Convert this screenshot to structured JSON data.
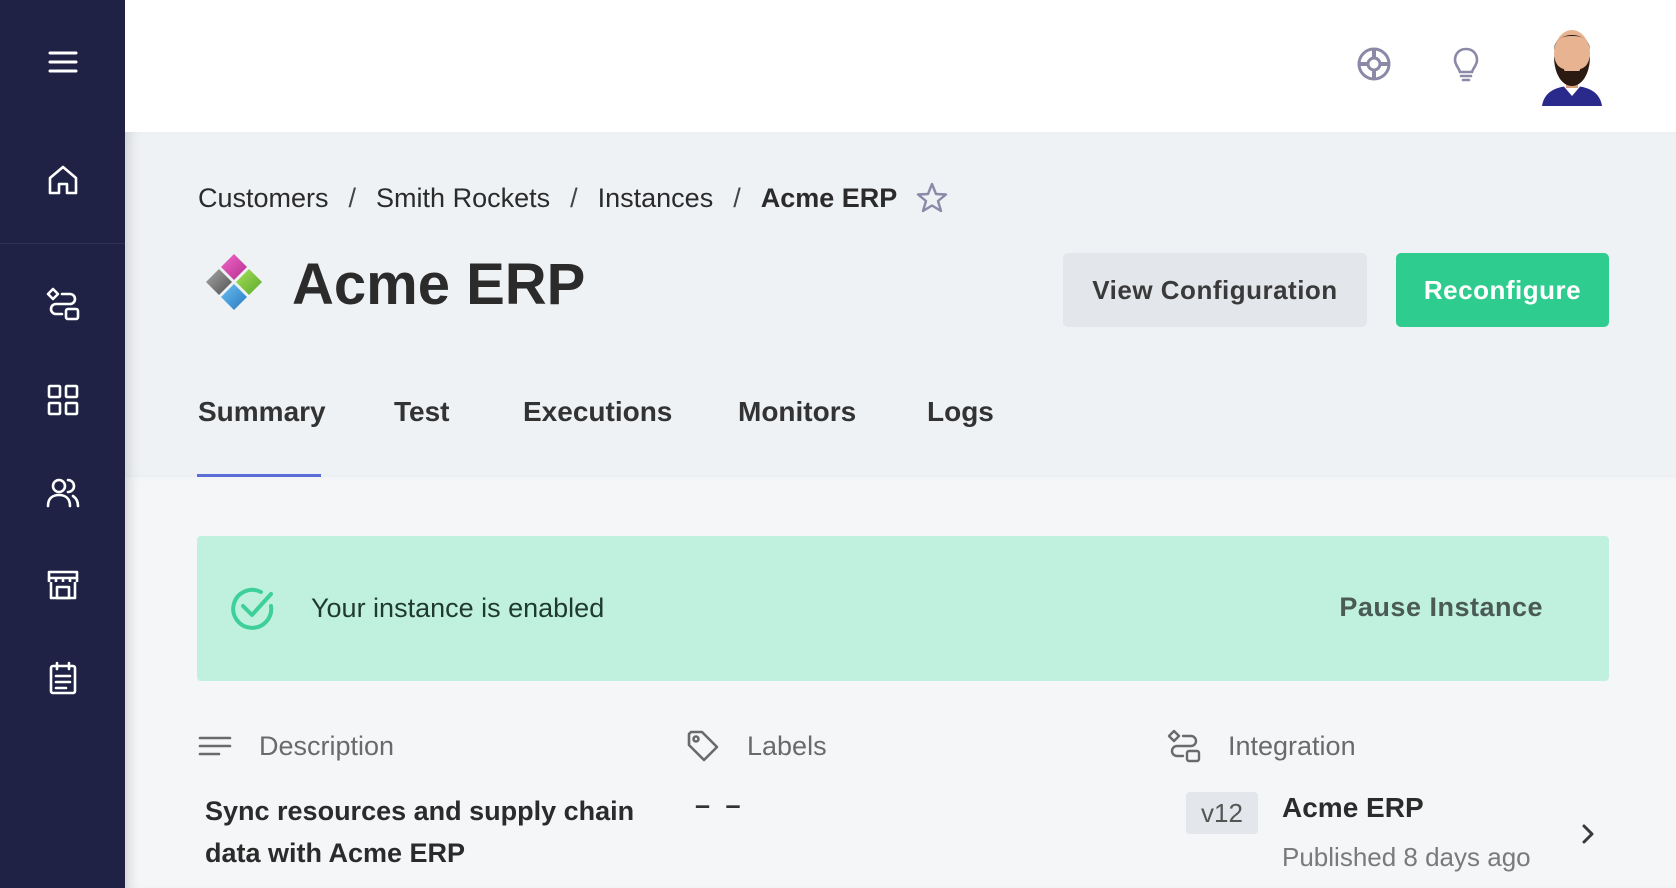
{
  "breadcrumb": {
    "items": [
      "Customers",
      "Smith Rockets",
      "Instances"
    ],
    "current": "Acme ERP",
    "separator": "/"
  },
  "page": {
    "title": "Acme ERP"
  },
  "actions": {
    "view_configuration": "View Configuration",
    "reconfigure": "Reconfigure"
  },
  "tabs": [
    {
      "label": "Summary",
      "active": true
    },
    {
      "label": "Test",
      "active": false
    },
    {
      "label": "Executions",
      "active": false
    },
    {
      "label": "Monitors",
      "active": false
    },
    {
      "label": "Logs",
      "active": false
    }
  ],
  "banner": {
    "message": "Your instance is enabled",
    "action": "Pause Instance"
  },
  "sections": {
    "description": {
      "heading": "Description",
      "text": "Sync resources and supply chain data with Acme ERP"
    },
    "labels": {
      "heading": "Labels",
      "value": "– –"
    },
    "integration": {
      "heading": "Integration",
      "version": "v12",
      "name": "Acme ERP",
      "published": "Published 8 days ago"
    }
  },
  "icons": {
    "sidebar": [
      "menu-icon",
      "home-icon",
      "integrations-icon",
      "components-icon",
      "customers-icon",
      "marketplace-icon",
      "logs-icon"
    ],
    "header": [
      "help-icon",
      "lightbulb-icon",
      "avatar"
    ]
  },
  "colors": {
    "sidebar": "#1f2244",
    "primary": "#2fcc8f",
    "tab_underline": "#5a6fd6",
    "banner_bg": "#c0f0de",
    "success": "#3dd09a"
  }
}
